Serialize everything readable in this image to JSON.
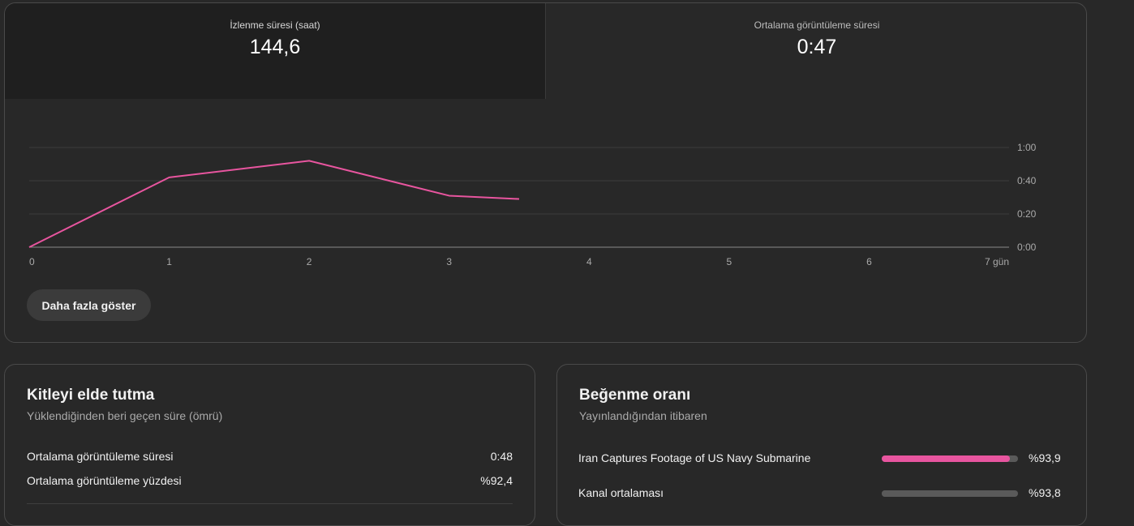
{
  "metrics": {
    "watch_time": {
      "label": "İzlenme süresi (saat)",
      "value": "144,6"
    },
    "avg_view_duration": {
      "label": "Ortalama görüntüleme süresi",
      "value": "0:47"
    }
  },
  "chart_data": {
    "type": "line",
    "x": [
      0,
      1,
      2,
      3,
      3.5
    ],
    "series": [
      {
        "values_seconds": [
          0,
          42,
          52,
          31,
          29
        ],
        "color": "#e8559f"
      }
    ],
    "x_ticks": [
      "0",
      "1",
      "2",
      "3",
      "4",
      "5",
      "6",
      "7 gün"
    ],
    "y_ticks": [
      "0:00",
      "0:20",
      "0:40",
      "1:00"
    ],
    "xlim": [
      0,
      7
    ],
    "ylim_seconds": [
      0,
      60
    ],
    "grid": true
  },
  "show_more_label": "Daha fazla göster",
  "retention": {
    "title": "Kitleyi elde tutma",
    "subtitle": "Yüklendiğinden beri geçen süre (ömrü)",
    "rows": [
      {
        "label": "Ortalama görüntüleme süresi",
        "value": "0:48"
      },
      {
        "label": "Ortalama görüntüleme yüzdesi",
        "value": "%92,4"
      }
    ]
  },
  "likes": {
    "title": "Beğenme oranı",
    "subtitle": "Yayınlandığından itibaren",
    "rows": [
      {
        "label": "Iran Captures Footage of US Navy Submarine",
        "value": "%93,9",
        "fraction": 0.939,
        "color": "#e8559f"
      },
      {
        "label": "Kanal ortalaması",
        "value": "%93,8",
        "fraction": 0.938,
        "color": "#5a5a5a"
      }
    ]
  }
}
